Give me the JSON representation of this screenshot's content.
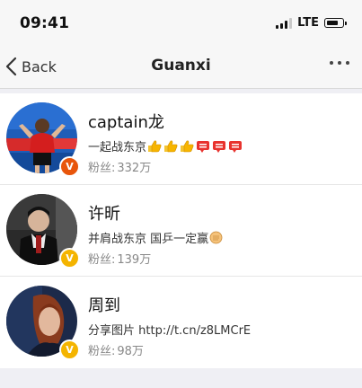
{
  "status_bar": {
    "time": "09:41",
    "network": "LTE"
  },
  "nav": {
    "back_label": "Back",
    "title": "Guanxi"
  },
  "fans_prefix": "粉丝:",
  "users": [
    {
      "name": "captain龙",
      "desc": "一起战东京",
      "fans": "332万",
      "badge": "V",
      "badge_color": "#e8550b",
      "emojis": [
        "thumbs-up-emoji",
        "thumbs-up-emoji",
        "thumbs-up-emoji",
        "cheer-emoji",
        "cheer-emoji",
        "cheer-emoji"
      ]
    },
    {
      "name": "许昕",
      "desc": "并肩战东京 国乒一定赢",
      "fans": "139万",
      "badge": "V",
      "badge_color": "#f4b400",
      "emojis": [
        "fist-emoji"
      ]
    },
    {
      "name": "周到",
      "desc": "分享图片 http://t.cn/z8LMCrE",
      "fans": "98万",
      "badge": "V",
      "badge_color": "#f4b400",
      "emojis": []
    }
  ]
}
